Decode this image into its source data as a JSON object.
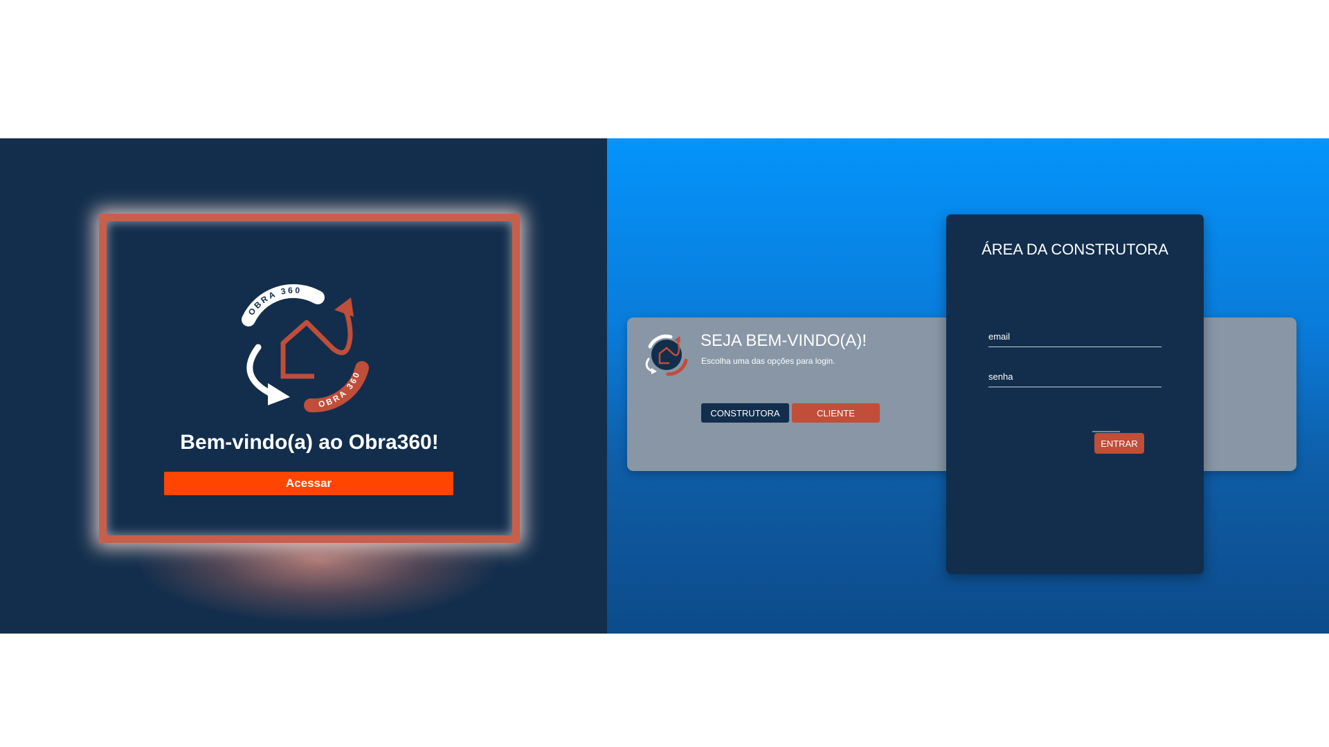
{
  "welcome_screen": {
    "logo_text_top": "OBRA 360",
    "logo_text_bottom": "OBRA 360",
    "title": "Bem-vindo(a) ao Obra360!",
    "access_button": "Acessar"
  },
  "login_screen": {
    "heading": "SEJA BEM-VINDO(A)!",
    "subtitle": "Escolha uma das opções para login.",
    "construtora_button": "CONSTRUTORA",
    "cliente_button": "CLIENTE",
    "area_title": "ÁREA DA CONSTRUTORA",
    "email_placeholder": "email",
    "senha_placeholder": "senha",
    "submit_button": "ENTRAR"
  },
  "colors": {
    "navy": "#122e4c",
    "brand_red": "#c04e39",
    "access_orange": "#ff4500",
    "blue_top": "#0494fb",
    "card_gray": "#8896a6"
  }
}
